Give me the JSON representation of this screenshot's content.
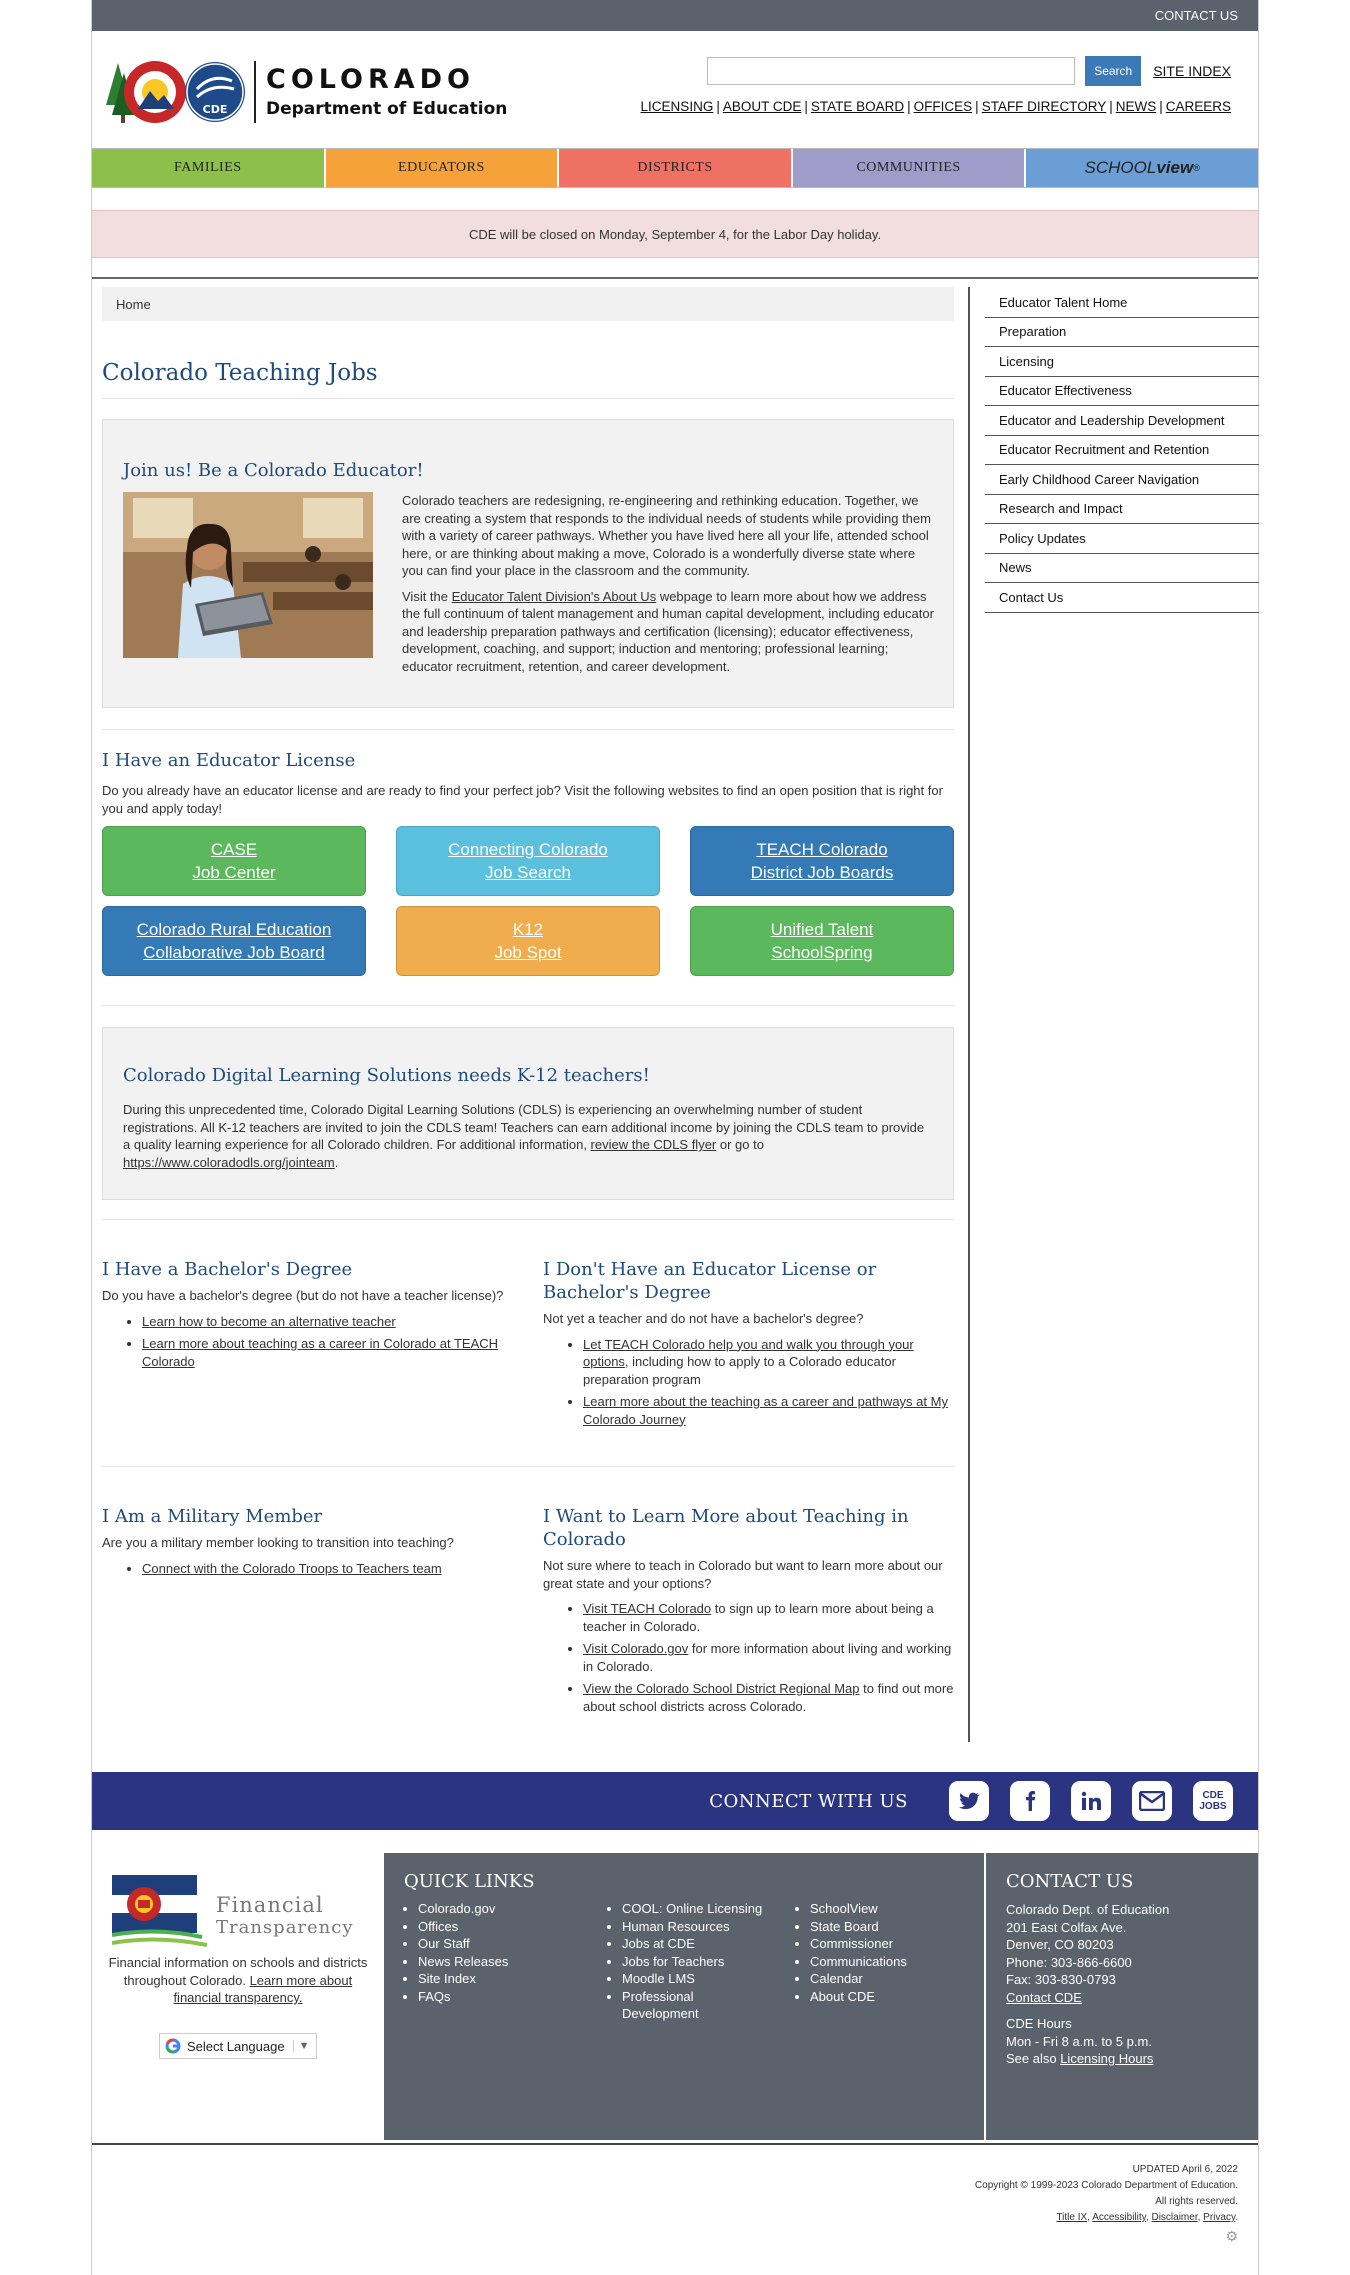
{
  "topbar": {
    "contact_label": "CONTACT US"
  },
  "header": {
    "logo_title": "COLORADO",
    "logo_subtitle": "Department of Education",
    "logo_badge": "CDE",
    "search_placeholder": "",
    "search_button": "Search",
    "site_index": "SITE INDEX",
    "utility_links": [
      "LICENSING",
      "ABOUT CDE",
      "STATE BOARD",
      "OFFICES",
      "STAFF DIRECTORY",
      "NEWS",
      "CAREERS"
    ]
  },
  "nav": {
    "items": [
      {
        "label": "FAMILIES",
        "color": "#8cc04b"
      },
      {
        "label": "EDUCATORS",
        "color": "#f5a23b"
      },
      {
        "label": "DISTRICTS",
        "color": "#ef7163"
      },
      {
        "label": "COMMUNITIES",
        "color": "#a09cc9"
      }
    ],
    "schoolview": {
      "part1": "SCHOOL",
      "part2": "view",
      "mark": "®",
      "color": "#6c9ed6"
    }
  },
  "alert": {
    "text": "CDE will be closed on Monday, September 4, for the Labor Day holiday."
  },
  "breadcrumb": {
    "home": "Home"
  },
  "page_title": "Colorado Teaching Jobs",
  "join": {
    "title": "Join us! Be a Colorado Educator!",
    "para1": "Colorado teachers are redesigning, re-engineering and rethinking education. Together, we are creating a system that responds to the individual needs of students while providing them with a variety of career pathways. Whether you have lived here all your life, attended school here, or are thinking about making a move, Colorado is a wonderfully diverse state where you can find your place in the classroom and the community.",
    "para2_pre": "Visit the ",
    "para2_link": "Educator Talent Division's About Us",
    "para2_post": " webpage to learn more about how we address the full continuum of talent management and human capital development, including educator and leadership preparation pathways and certification (licensing); educator effectiveness, development, coaching, and support; induction and mentoring; professional learning; educator recruitment, retention, and career development."
  },
  "license": {
    "title": "I Have an Educator License",
    "text": "Do you already have an educator license and are ready to find your perfect job? Visit the following websites to find an open position that is right for you and apply today!",
    "buttons": [
      {
        "line1": "CASE",
        "line2": "Job Center",
        "color": "#5cb85c"
      },
      {
        "line1": "Connecting Colorado",
        "line2": "Job Search",
        "color": "#5bc0de"
      },
      {
        "line1": "TEACH Colorado",
        "line2": "District Job Boards",
        "color": "#337ab7"
      },
      {
        "line1": "Colorado Rural Education",
        "line2": "Collaborative Job Board",
        "color": "#337ab7"
      },
      {
        "line1": "K12",
        "line2": "Job Spot",
        "color": "#f0ad4e"
      },
      {
        "line1": "Unified Talent",
        "line2": "SchoolSpring",
        "color": "#5cb85c"
      }
    ]
  },
  "cdls": {
    "title": "Colorado Digital Learning Solutions needs K-12 teachers!",
    "text_pre": "During this unprecedented time, Colorado Digital Learning Solutions (CDLS) is experiencing an overwhelming number of student registrations.  All K-12 teachers are invited to join the CDLS team!  Teachers can earn additional income by joining the CDLS team to provide a quality learning experience for all Colorado children.  For additional information, ",
    "link1": "review the CDLS flyer",
    "text_mid": " or go to ",
    "link2": "https://www.coloradodls.org/jointeam",
    "text_post": "."
  },
  "bachelor": {
    "title": "I Have a Bachelor's Degree",
    "text": "Do you have a bachelor's degree (but do not have a teacher license)?",
    "links": [
      "Learn how to become an alternative teacher",
      "Learn more about teaching as a career in Colorado at TEACH Colorado"
    ]
  },
  "no_license": {
    "title": "I Don't Have an Educator License or Bachelor's Degree",
    "text": "Not yet a teacher and do not have a bachelor's degree?",
    "item1_link": "Let TEACH Colorado help you and walk you through your options",
    "item1_post": ", including how to apply to a Colorado educator preparation program",
    "item2_link": "Learn more about the teaching as a career and pathways at My Colorado Journey"
  },
  "military": {
    "title": "I Am a Military Member",
    "text": "Are you a military member looking to transition into teaching?",
    "link": "Connect with the Colorado Troops to Teachers team"
  },
  "learn_more": {
    "title": "I Want to Learn More about Teaching in Colorado",
    "text": "Not sure where to teach in Colorado but want to learn more about our great state and your options?",
    "items": [
      {
        "link": "Visit TEACH Colorado",
        "post": " to sign up to learn more about being a teacher in Colorado."
      },
      {
        "link": "Visit Colorado.gov",
        "post": " for more information about living and working in Colorado."
      },
      {
        "link": "View the Colorado School District Regional Map",
        "post": " to find out more about school districts across Colorado."
      }
    ]
  },
  "sidebar": {
    "items": [
      "Educator Talent Home",
      "Preparation",
      "Licensing",
      "Educator Effectiveness",
      "Educator and Leadership Development",
      "Educator Recruitment and Retention",
      "Early Childhood Career Navigation",
      "Research and Impact",
      "Policy Updates",
      "News",
      "Contact Us"
    ]
  },
  "connect": {
    "label": "CONNECT WITH US",
    "icons": [
      "twitter-icon",
      "facebook-icon",
      "linkedin-icon",
      "email-icon",
      "cde-jobs-icon"
    ],
    "jobs_line1": "CDE",
    "jobs_line2": "JOBS"
  },
  "footer": {
    "ft_title1": "Financial",
    "ft_title2": "Transparency",
    "ft_text": "Financial information on schools and districts throughout Colorado. ",
    "ft_link": "Learn more about financial transparency.",
    "language": "Select Language",
    "quick_links_title": "QUICK LINKS",
    "col1": [
      "Colorado.gov",
      "Offices",
      "Our Staff",
      "News Releases",
      "Site Index",
      "FAQs"
    ],
    "col2": [
      "COOL: Online Licensing",
      "Human Resources",
      "Jobs at CDE",
      "Jobs for Teachers",
      "Moodle LMS",
      "Professional Development"
    ],
    "col3": [
      "SchoolView",
      "State Board",
      "Commissioner",
      "Communications",
      "Calendar",
      "About CDE"
    ],
    "contact_title": "CONTACT US",
    "contact_lines": [
      "Colorado Dept. of Education",
      "201 East Colfax Ave.",
      "Denver, CO 80203",
      "Phone: 303-866-6600",
      "Fax: 303-830-0793"
    ],
    "contact_link": "Contact CDE",
    "hours_title": "CDE Hours",
    "hours": "Mon - Fri 8 a.m. to 5 p.m.",
    "see_also": "See also ",
    "licensing_hours": "Licensing Hours"
  },
  "bottom": {
    "updated": "UPDATED April 6, 2022",
    "copyright": "Copyright © 1999-2023 Colorado Department of Education.",
    "rights": "All rights reserved.",
    "links": [
      "Title IX",
      "Accessibility",
      "Disclaimer",
      "Privacy"
    ]
  }
}
